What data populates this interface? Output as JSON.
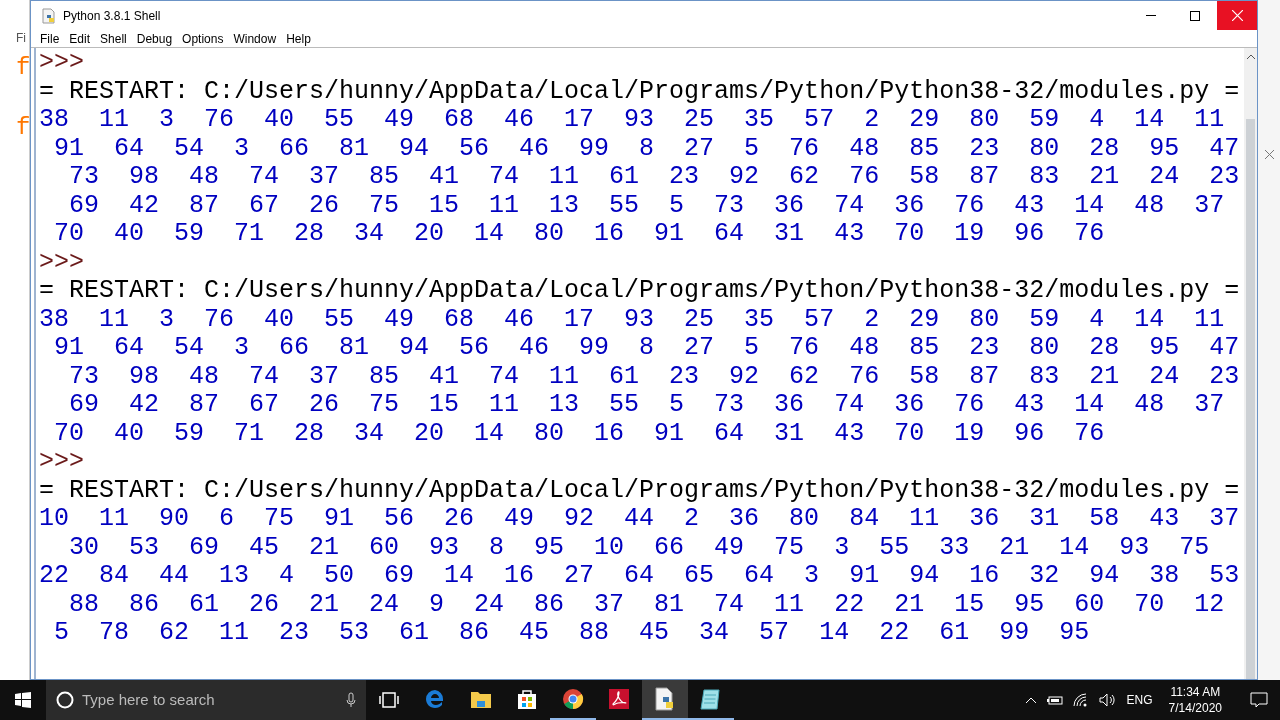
{
  "window": {
    "title": "Python 3.8.1 Shell"
  },
  "background_window": {
    "menu_fragment": "Fi",
    "code_fragments": [
      "f",
      "f"
    ]
  },
  "menu": [
    "File",
    "Edit",
    "Shell",
    "Debug",
    "Options",
    "Window",
    "Help"
  ],
  "shell_lines": [
    {
      "kind": "prompt",
      "text": ">>>"
    },
    {
      "kind": "restart",
      "text": "= RESTART: C:/Users/hunny/AppData/Local/Programs/Python/Python38-32/modules.py ="
    },
    {
      "kind": "output",
      "text": "38  11  3  76  40  55  49  68  46  17  93  25  35  57  2  29  80  59  4  14  11"
    },
    {
      "kind": "output",
      "text": " 91  64  54  3  66  81  94  56  46  99  8  27  5  76  48  85  23  80  28  95  47"
    },
    {
      "kind": "output",
      "text": "  73  98  48  74  37  85  41  74  11  61  23  92  62  76  58  87  83  21  24  23"
    },
    {
      "kind": "output",
      "text": "  69  42  87  67  26  75  15  11  13  55  5  73  36  74  36  76  43  14  48  37"
    },
    {
      "kind": "output",
      "text": " 70  40  59  71  28  34  20  14  80  16  91  64  31  43  70  19  96  76"
    },
    {
      "kind": "prompt",
      "text": ">>>"
    },
    {
      "kind": "restart",
      "text": "= RESTART: C:/Users/hunny/AppData/Local/Programs/Python/Python38-32/modules.py ="
    },
    {
      "kind": "output",
      "text": "38  11  3  76  40  55  49  68  46  17  93  25  35  57  2  29  80  59  4  14  11"
    },
    {
      "kind": "output",
      "text": " 91  64  54  3  66  81  94  56  46  99  8  27  5  76  48  85  23  80  28  95  47"
    },
    {
      "kind": "output",
      "text": "  73  98  48  74  37  85  41  74  11  61  23  92  62  76  58  87  83  21  24  23"
    },
    {
      "kind": "output",
      "text": "  69  42  87  67  26  75  15  11  13  55  5  73  36  74  36  76  43  14  48  37"
    },
    {
      "kind": "output",
      "text": " 70  40  59  71  28  34  20  14  80  16  91  64  31  43  70  19  96  76"
    },
    {
      "kind": "prompt",
      "text": ">>>"
    },
    {
      "kind": "restart",
      "text": "= RESTART: C:/Users/hunny/AppData/Local/Programs/Python/Python38-32/modules.py ="
    },
    {
      "kind": "output",
      "text": "10  11  90  6  75  91  56  26  49  92  44  2  36  80  84  11  36  31  58  43  37"
    },
    {
      "kind": "output",
      "text": "  30  53  69  45  21  60  93  8  95  10  66  49  75  3  55  33  21  14  93  75"
    },
    {
      "kind": "output",
      "text": "22  84  44  13  4  50  69  14  16  27  64  65  64  3  91  94  16  32  94  38  53"
    },
    {
      "kind": "output",
      "text": "  88  86  61  26  21  24  9  24  86  37  81  74  11  22  21  15  95  60  70  12"
    },
    {
      "kind": "output",
      "text": " 5  78  62  11  23  53  61  86  45  88  45  34  57  14  22  61  99  95"
    }
  ],
  "taskbar": {
    "search": {
      "placeholder": "Type here to search"
    },
    "apps": [
      {
        "kind": "edge",
        "selected": false,
        "running": false
      },
      {
        "kind": "folder",
        "selected": false,
        "running": false
      },
      {
        "kind": "store",
        "selected": false,
        "running": false
      },
      {
        "kind": "chrome",
        "selected": false,
        "running": true
      },
      {
        "kind": "acrobat",
        "selected": false,
        "running": false
      },
      {
        "kind": "python",
        "selected": true,
        "running": true
      },
      {
        "kind": "notepad",
        "selected": false,
        "running": true
      }
    ],
    "tray": {
      "language": "ENG",
      "time": "11:34 AM",
      "date": "7/14/2020"
    }
  }
}
